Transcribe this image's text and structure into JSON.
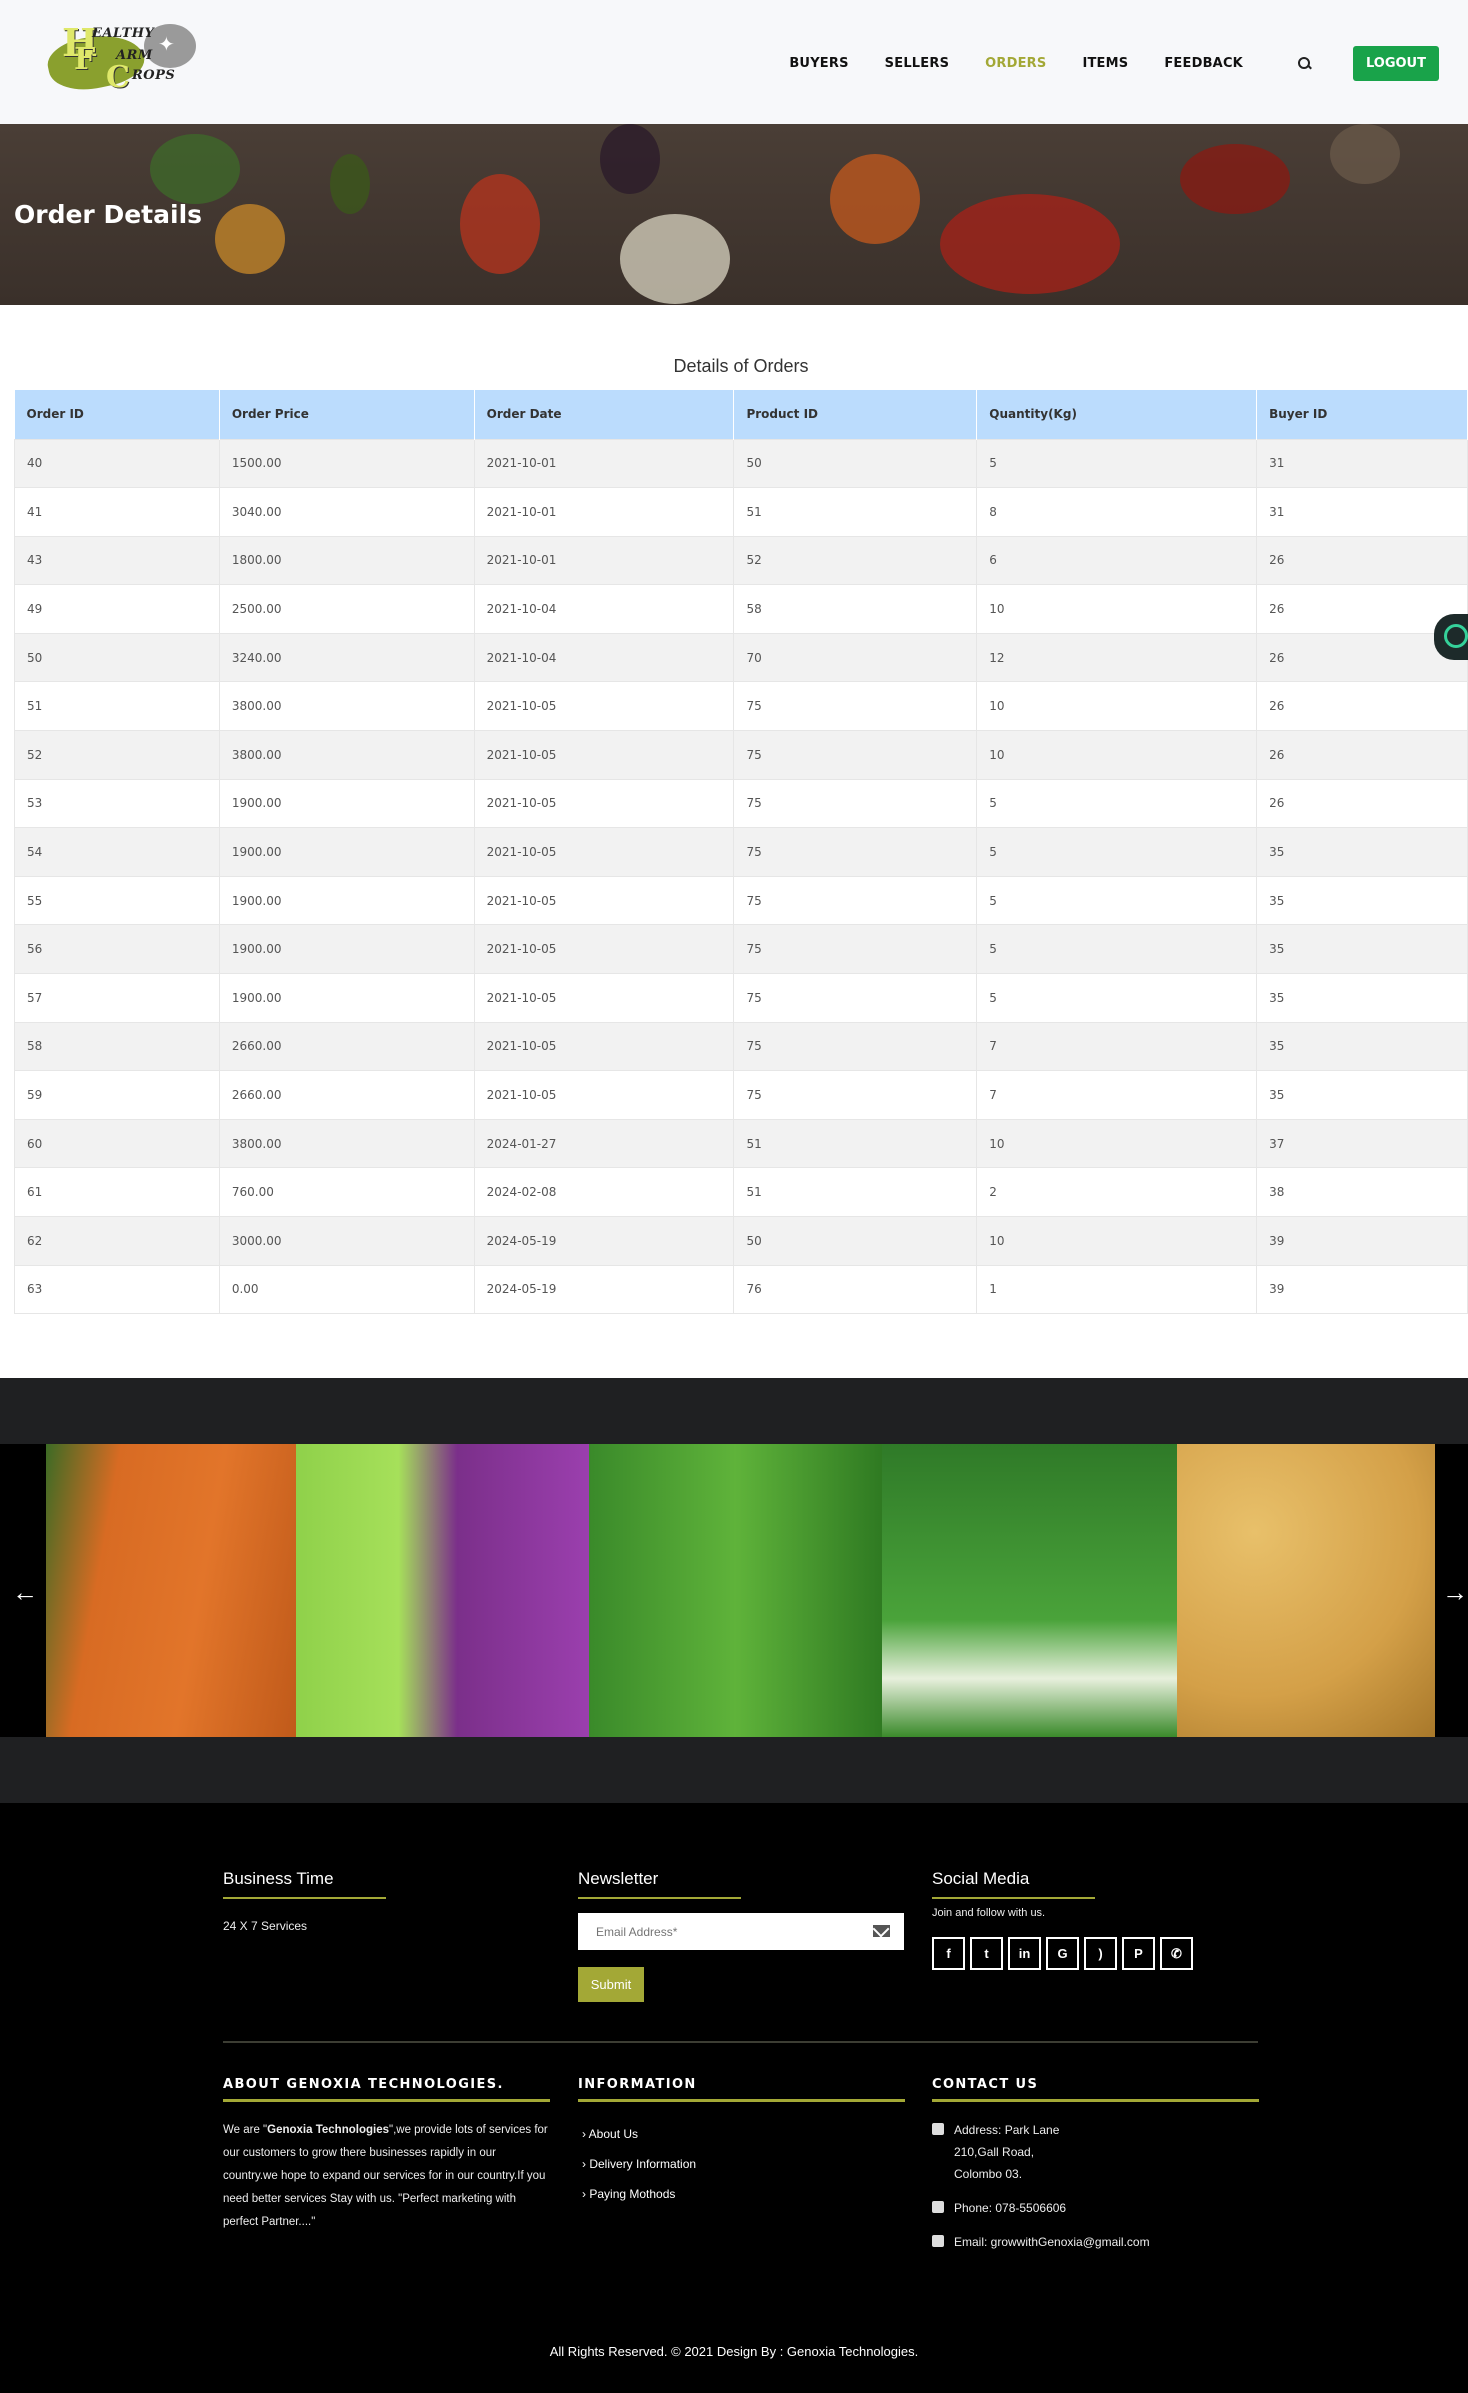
{
  "brand": {
    "logo_letters": [
      "H",
      "F",
      "C"
    ],
    "logo_words": [
      "EALTHY",
      "ARM",
      "ROPS"
    ]
  },
  "nav": {
    "items": [
      "BUYERS",
      "SELLERS",
      "ORDERS",
      "ITEMS",
      "FEEDBACK"
    ],
    "active": "ORDERS",
    "logout": "LOGOUT"
  },
  "hero": {
    "title": "Order Details"
  },
  "table": {
    "caption": "Details of Orders",
    "headers": [
      "Order ID",
      "Order Price",
      "Order Date",
      "Product ID",
      "Quantity(Kg)",
      "Buyer ID"
    ],
    "rows": [
      [
        "40",
        "1500.00",
        "2021-10-01",
        "50",
        "5",
        "31"
      ],
      [
        "41",
        "3040.00",
        "2021-10-01",
        "51",
        "8",
        "31"
      ],
      [
        "43",
        "1800.00",
        "2021-10-01",
        "52",
        "6",
        "26"
      ],
      [
        "49",
        "2500.00",
        "2021-10-04",
        "58",
        "10",
        "26"
      ],
      [
        "50",
        "3240.00",
        "2021-10-04",
        "70",
        "12",
        "26"
      ],
      [
        "51",
        "3800.00",
        "2021-10-05",
        "75",
        "10",
        "26"
      ],
      [
        "52",
        "3800.00",
        "2021-10-05",
        "75",
        "10",
        "26"
      ],
      [
        "53",
        "1900.00",
        "2021-10-05",
        "75",
        "5",
        "26"
      ],
      [
        "54",
        "1900.00",
        "2021-10-05",
        "75",
        "5",
        "35"
      ],
      [
        "55",
        "1900.00",
        "2021-10-05",
        "75",
        "5",
        "35"
      ],
      [
        "56",
        "1900.00",
        "2021-10-05",
        "75",
        "5",
        "35"
      ],
      [
        "57",
        "1900.00",
        "2021-10-05",
        "75",
        "5",
        "35"
      ],
      [
        "58",
        "2660.00",
        "2021-10-05",
        "75",
        "7",
        "35"
      ],
      [
        "59",
        "2660.00",
        "2021-10-05",
        "75",
        "7",
        "35"
      ],
      [
        "60",
        "3800.00",
        "2024-01-27",
        "51",
        "10",
        "37"
      ],
      [
        "61",
        "760.00",
        "2024-02-08",
        "51",
        "2",
        "38"
      ],
      [
        "62",
        "3000.00",
        "2024-05-19",
        "50",
        "10",
        "39"
      ],
      [
        "63",
        "0.00",
        "2024-05-19",
        "76",
        "1",
        "39"
      ]
    ]
  },
  "carousel": {
    "prev_icon": "arrow-left-icon",
    "next_icon": "arrow-right-icon"
  },
  "footer": {
    "business": {
      "title": "Business Time",
      "text": "24 X 7 Services"
    },
    "newsletter": {
      "title": "Newsletter",
      "placeholder": "Email Address*",
      "submit": "Submit"
    },
    "social": {
      "title": "Social Media",
      "text": "Join and follow with us.",
      "icons": [
        "facebook-icon",
        "twitter-icon",
        "linkedin-icon",
        "google-icon",
        "rss-icon",
        "pinterest-icon",
        "whatsapp-icon"
      ]
    },
    "about": {
      "title": "ABOUT GENOXIA TECHNOLOGIES.",
      "prefix": "We are \"",
      "bold": "Genoxia Technologies",
      "text": "\",we provide lots of services for our customers to grow there businesses rapidly in our country.we hope to expand our services for in our country.If you need better services Stay with us. \"Perfect marketing with perfect Partner....\""
    },
    "information": {
      "title": "INFORMATION",
      "links": [
        "About Us",
        "Delivery Information",
        "Paying Mothods"
      ]
    },
    "contact": {
      "title": "CONTACT US",
      "address": [
        "Address: Park Lane",
        "210,Gall Road,",
        "Colombo 03."
      ],
      "phone": "Phone: 078-5506606",
      "email": "Email: growwithGenoxia@gmail.com"
    },
    "copyright": "All Rights Reserved. © 2021 Design By : Genoxia Technologies."
  }
}
